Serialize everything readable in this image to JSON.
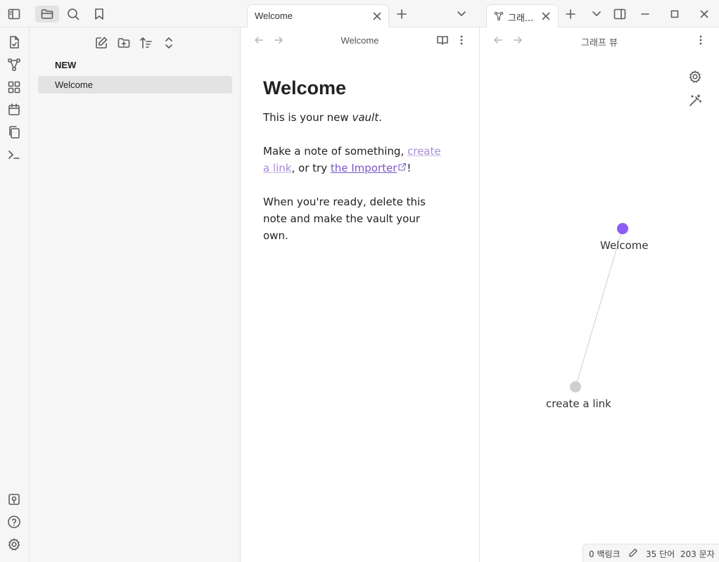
{
  "ribbon": {
    "top_items": [
      {
        "name": "new-note-from-template-icon"
      },
      {
        "name": "graph-view-icon"
      },
      {
        "name": "canvas-icon"
      },
      {
        "name": "daily-note-icon"
      },
      {
        "name": "copy-icon"
      },
      {
        "name": "command-palette-icon"
      }
    ],
    "bottom_items": [
      {
        "name": "vault-switcher-icon"
      },
      {
        "name": "help-icon"
      },
      {
        "name": "settings-icon"
      }
    ]
  },
  "explorer": {
    "folder": "NEW",
    "files": [
      "Welcome"
    ]
  },
  "pane1": {
    "tab_label": "Welcome",
    "nav_title": "Welcome",
    "note": {
      "heading": "Welcome",
      "p1_before": "This is your new ",
      "p1_em": "vault",
      "p1_after": ".",
      "p2_before": "Make a note of something, ",
      "p2_link1": "create a link",
      "p2_mid": ", or try ",
      "p2_link2": "the Importer",
      "p2_after": "!",
      "p3": "When you're ready, delete this note and make the vault your own."
    }
  },
  "pane2": {
    "tab_label": "그래...",
    "nav_title": "그래프 뷰",
    "graph": {
      "nodes": [
        {
          "label": "Welcome",
          "color": "#8b5cf6"
        },
        {
          "label": "create a link",
          "color": "#cfcfcf"
        }
      ]
    }
  },
  "status": {
    "backlinks": "0 백링크",
    "words": "35 단어",
    "chars": "203 문자"
  },
  "colors": {
    "accent": "#8b5cf6",
    "internal_link": "#a88bd6",
    "external_link": "#7b55c7"
  }
}
